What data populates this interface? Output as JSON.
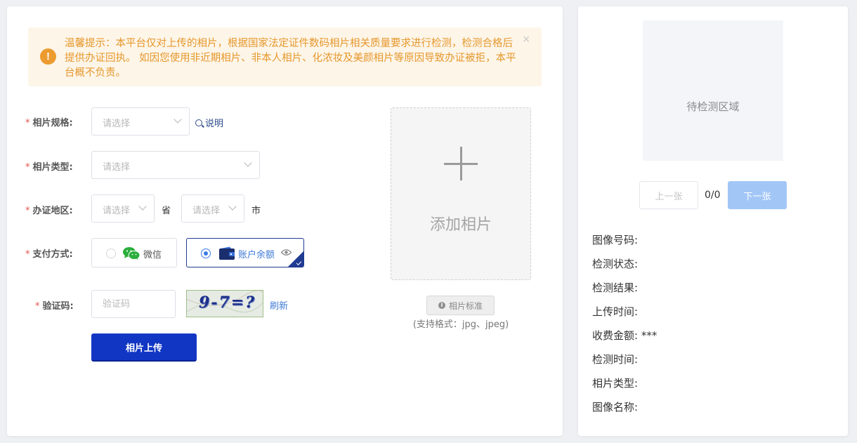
{
  "alert": {
    "text": "温馨提示：本平台仅对上传的相片，根据国家法定证件数码相片相关质量要求进行检测，检测合格后提供办证回执。 如因您使用非近期相片、非本人相片、化浓妆及美颜相片等原因导致办证被拒，本平台概不负责。",
    "icon": "!",
    "close": "×"
  },
  "form": {
    "spec": {
      "label": "相片规格:",
      "placeholder": "请选择",
      "help_link": "说明"
    },
    "type": {
      "label": "相片类型:",
      "placeholder": "请选择"
    },
    "region": {
      "label": "办证地区:",
      "province_placeholder": "请选择",
      "province_suffix": "省",
      "city_placeholder": "请选择",
      "city_suffix": "市"
    },
    "payment": {
      "label": "支付方式:",
      "options": [
        {
          "label": "微信",
          "selected": false,
          "icon": "wechat-icon"
        },
        {
          "label": "账户余额",
          "selected": true,
          "icon": "wallet-icon"
        }
      ]
    },
    "captcha": {
      "label": "验证码:",
      "placeholder": "验证码",
      "image_text": "9-7=?",
      "refresh": "刷新"
    },
    "submit": "相片上传",
    "required_mark": "*"
  },
  "upload": {
    "label": "添加相片",
    "standard_button": "相片标准",
    "formats": "(支持格式：jpg、jpeg)"
  },
  "viewer": {
    "area_label": "待检测区域",
    "prev": "上一张",
    "next": "下一张",
    "counter": "0/0"
  },
  "info": {
    "image_number": "图像号码:",
    "status": "检测状态:",
    "result": "检测结果:",
    "upload_time": "上传时间:",
    "fee": "收费金额: ***",
    "detect_time": "检测时间:",
    "photo_type": "相片类型:",
    "image_name": "图像名称:"
  },
  "colors": {
    "primary": "#1236c4",
    "alert_text": "#e6982d",
    "alert_bg": "#fdf5e8",
    "required": "#e5534b",
    "link": "#3f7ad6"
  }
}
